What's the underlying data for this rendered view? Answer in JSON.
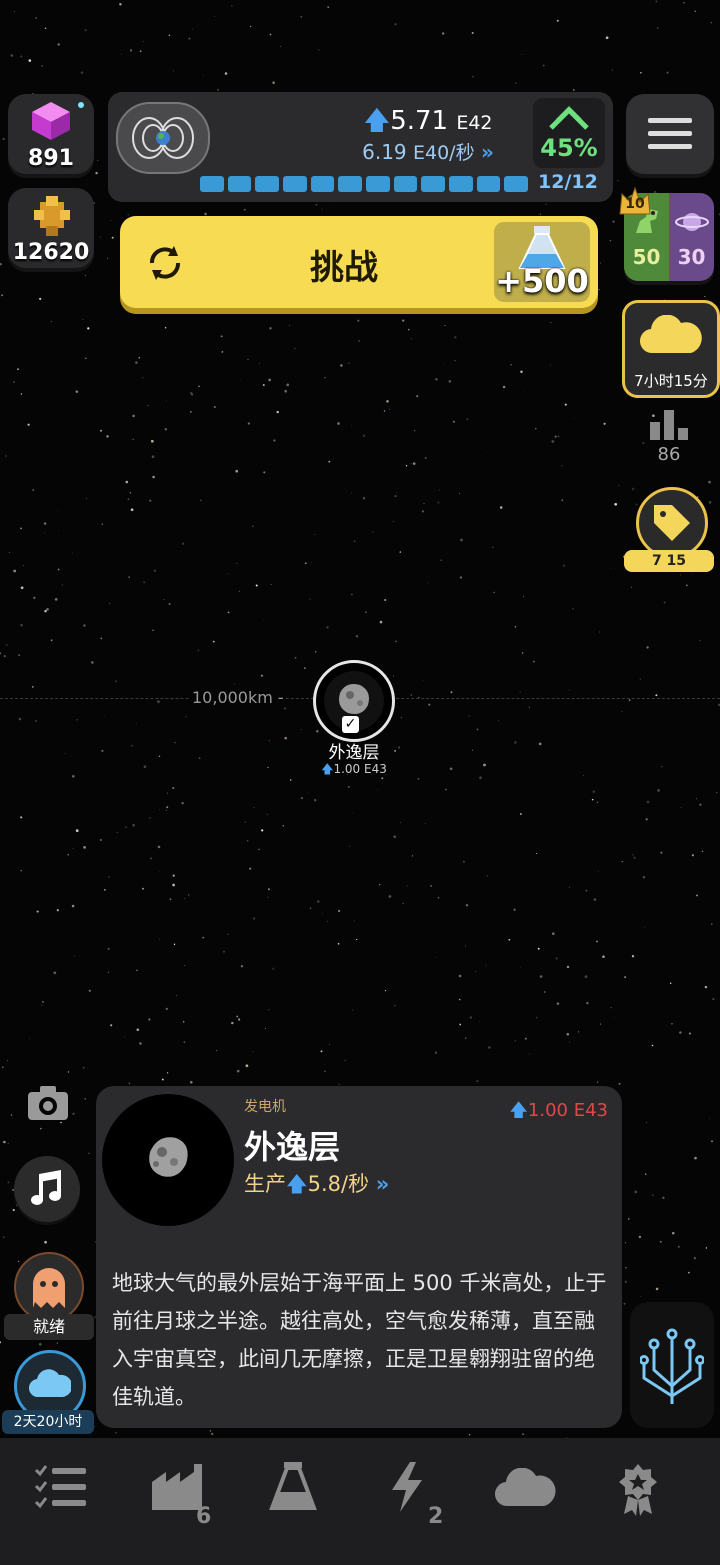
{
  "resources": {
    "gems": "891",
    "gems_icon": "cube-icon",
    "blocks": "12620",
    "blocks_icon": "gold-block-icon"
  },
  "topbar": {
    "energy_mantissa": "5.71",
    "energy_exp": "E42",
    "rate_mantissa": "6.19",
    "rate_suffix": "E40/秒",
    "percent": "45%",
    "progress_label": "12/12",
    "progress_filled": 12,
    "progress_total": 12
  },
  "challenge": {
    "label": "挑战",
    "reward": "+500",
    "reward_icon": "flask-icon"
  },
  "side": {
    "badge_level": "10",
    "dino_count": "50",
    "planet_count": "30",
    "cloud_timer": "7小时15分",
    "stats_count": "86",
    "tag_label": "7  15"
  },
  "planet": {
    "distance": "10,000km -",
    "name": "外逸层",
    "value": "1.00 E43"
  },
  "tools": {
    "ghost_label": "就绪",
    "cloud_label": "2天20小时"
  },
  "info": {
    "category": "发电机",
    "title": "外逸层",
    "value": "1.00 E43",
    "production": "生产",
    "production_rate": "5.8/秒",
    "description": "地球大气的最外层始于海平面上 500 千米高处，止于前往月球之半途。越往高处，空气愈发稀薄，直至融入宇宙真空，此间几无摩擦，正是卫星翱翔驻留的绝佳轨道。"
  },
  "nav": {
    "factory_badge": "6",
    "power_badge": "2"
  },
  "colors": {
    "accent_yellow": "#f7db52",
    "progress_blue": "#3a9ad6",
    "green": "#6ee07f",
    "red": "#e04848"
  }
}
